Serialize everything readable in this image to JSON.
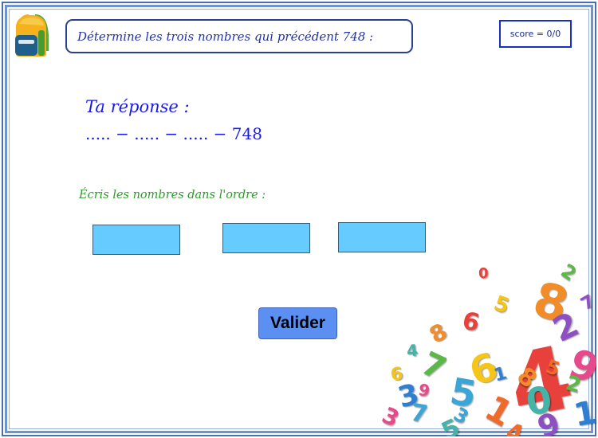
{
  "app": {
    "instruction": "Détermine les trois nombres qui précédent 748 :",
    "score_label": "score = 0/0"
  },
  "answer": {
    "title": "Ta réponse :",
    "pattern": "..... − ..... − ..... − 748"
  },
  "order": {
    "instruction": "Écris les nombres dans l'ordre :"
  },
  "inputs": [
    {
      "value": ""
    },
    {
      "value": ""
    },
    {
      "value": ""
    }
  ],
  "actions": {
    "validate_label": "Valider"
  },
  "decoration": {
    "numbers": [
      "4",
      "8",
      "6",
      "7",
      "5",
      "2",
      "9",
      "3",
      "1",
      "0",
      "6",
      "8",
      "5",
      "2",
      "7",
      "9",
      "3",
      "1",
      "4",
      "5",
      "0",
      "8",
      "6",
      "2",
      "3",
      "7",
      "9",
      "1",
      "5",
      "4"
    ],
    "colors": [
      "#e8413c",
      "#f28c28",
      "#f5c518",
      "#5ab847",
      "#3aa6d8",
      "#8e4fc2",
      "#e64a8a",
      "#2e7fd1",
      "#f06a2a",
      "#44b3a8"
    ]
  },
  "icons": {
    "backpack": "backpack-icon"
  }
}
